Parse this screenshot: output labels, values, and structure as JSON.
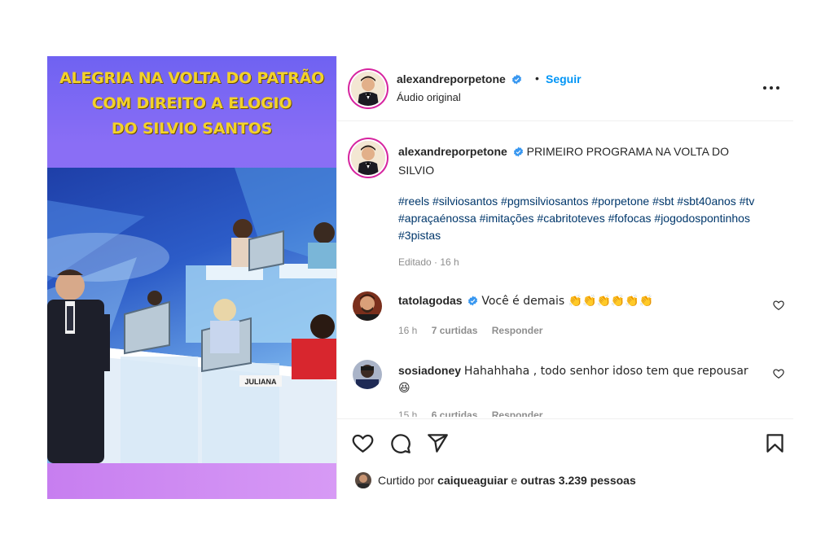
{
  "media": {
    "caption_lines": [
      "ALEGRIA NA VOLTA DO PATRÃO",
      "COM DIREITO A ELOGIO",
      "DO SILVIO  SANTOS"
    ],
    "nameplate": "JULIANA"
  },
  "post_header": {
    "username": "alexandreporpetone",
    "separator": "•",
    "follow_label": "Seguir",
    "audio_label": "Áudio original",
    "more_icon": "more-options-icon"
  },
  "caption": {
    "username": "alexandreporpetone",
    "text": "PRIMEIRO PROGRAMA NA VOLTA DO SILVIO",
    "hashtags": "#reels #silviosantos #pgmsilviosantos #porpetone #sbt #sbt40anos #tv #apraçaénossa #imitações #cabritoteves #fofocas #jogodospontinhos #3pistas",
    "edited": "Editado · 16 h"
  },
  "comments": [
    {
      "username": "tatolagodas",
      "verified": true,
      "text": "Você é demais 👏👏👏👏👏👏",
      "time": "16 h",
      "likes": "7 curtidas",
      "reply": "Responder"
    },
    {
      "username": "sosiadoney",
      "verified": false,
      "text": "Hahahhaha , todo senhor idoso tem que repousar 😆",
      "time": "15 h",
      "likes": "6 curtidas",
      "reply": "Responder"
    }
  ],
  "actions": {
    "icons": [
      "like-icon",
      "comment-icon",
      "share-icon",
      "save-icon"
    ]
  },
  "likes_summary": {
    "prefix": "Curtido por",
    "user": "caiqueaguiar",
    "suffix": "e outras 3.239 pessoas"
  },
  "colors": {
    "follow_blue": "#0095f6",
    "verified_blue": "#3897f0",
    "hashtag": "#00376b",
    "caption_yellow": "#f2d22a",
    "media_purple": "#7f74f0"
  }
}
